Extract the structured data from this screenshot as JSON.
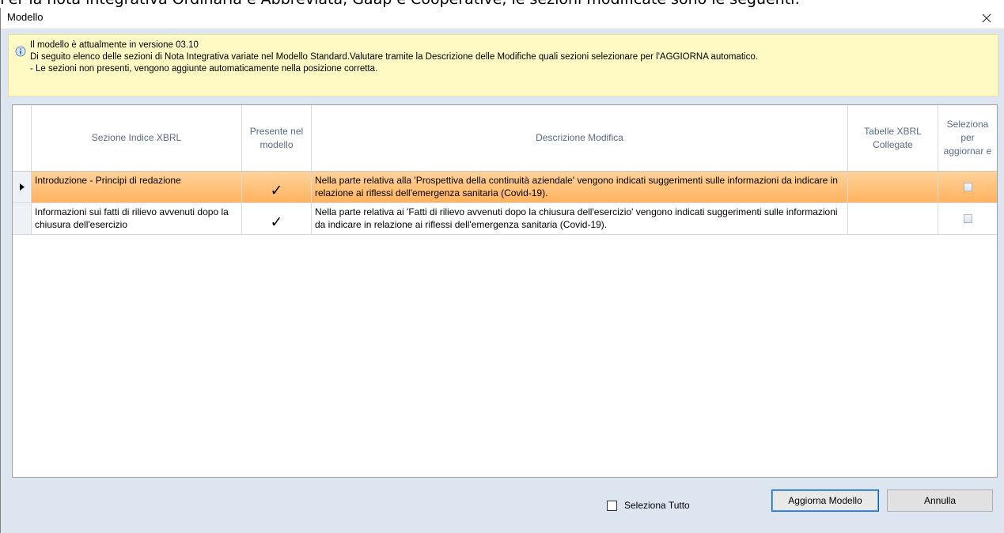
{
  "background_text": "Per la nota integrativa Ordinaria e Abbreviata, Gaap e Cooperative, le sezioni modificate sono le seguenti:",
  "window": {
    "title": "Modello",
    "close_glyph": "✕"
  },
  "info": {
    "icon": "info-icon",
    "lines": [
      "Il modello è attualmente in versione 03.10",
      "Di seguito elenco delle sezioni di Nota Integrativa variate nel Modello Standard.Valutare tramite la Descrizione delle Modifiche quali sezioni selezionare per l'AGGIORNA automatico.",
      "- Le sezioni non presenti, vengono aggiunte automaticamente nella posizione corretta."
    ]
  },
  "table": {
    "columns": {
      "sezione": "Sezione Indice XBRL",
      "presente": "Presente nel modello",
      "descrizione": "Descrizione Modifica",
      "tabelle": "Tabelle XBRL Collegate",
      "seleziona": "Seleziona per aggiornar e"
    },
    "rows": [
      {
        "sezione": "Introduzione - Principi di redazione",
        "presente": "✓",
        "descrizione": "Nella parte relativa alla 'Prospettiva della continuità aziendale' vengono indicati suggerimenti sulle informazioni da indicare in relazione ai riflessi dell'emergenza sanitaria (Covid-19).",
        "tabelle": "",
        "selected": true
      },
      {
        "sezione": "Informazioni sui fatti di rilievo avvenuti dopo la chiusura dell'esercizio",
        "presente": "✓",
        "descrizione": "Nella parte relativa ai 'Fatti di rilievo avvenuti dopo la chiusura dell'esercizio' vengono indicati suggerimenti sulle informazioni da indicare in relazione ai riflessi dell'emergenza sanitaria (Covid-19).",
        "tabelle": "",
        "selected": false
      }
    ]
  },
  "footer": {
    "select_all_label": "Seleziona Tutto",
    "update_button": "Aggiorna Modello",
    "cancel_button": "Annulla"
  },
  "colors": {
    "selected_row": "#ffb35f",
    "info_background": "#fff9c4",
    "dialog_background": "#dde6f0"
  }
}
